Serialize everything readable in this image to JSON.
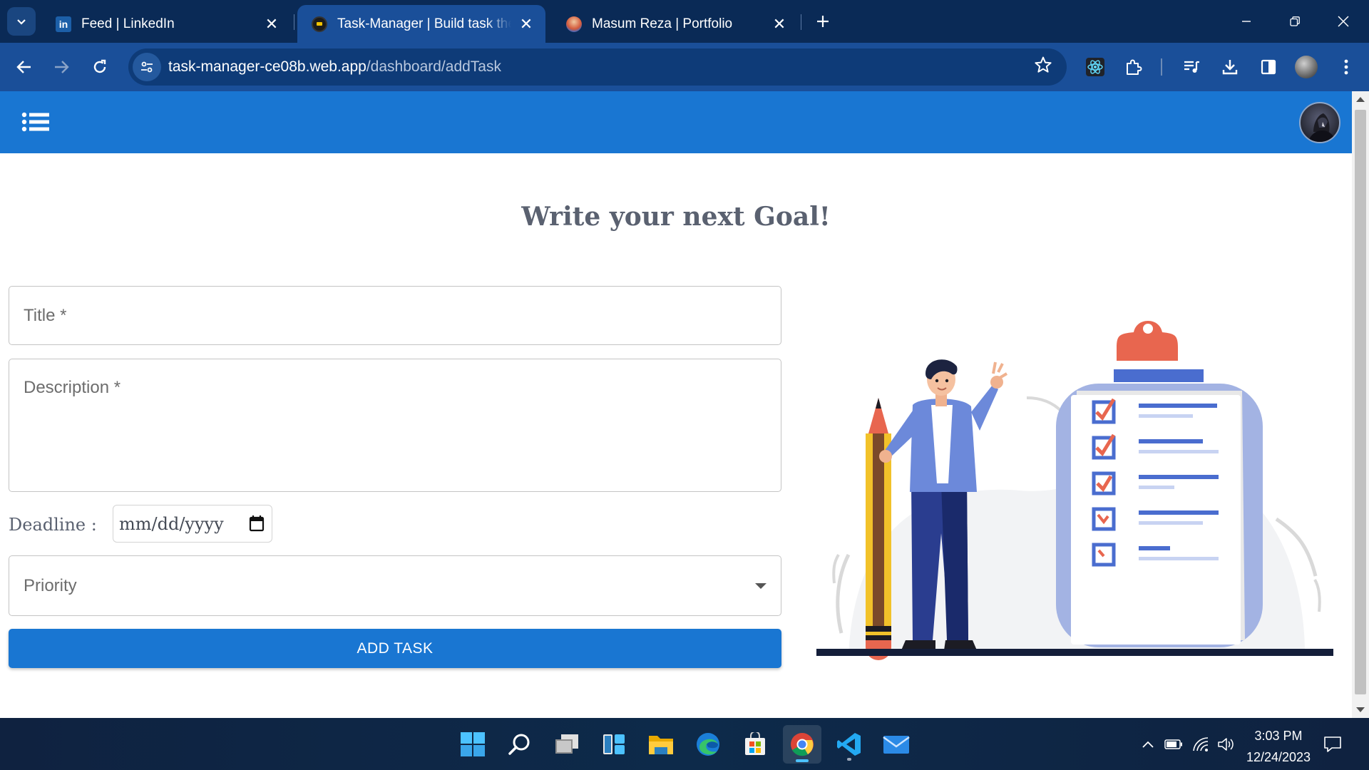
{
  "browser": {
    "tabs": [
      {
        "title": "Feed | LinkedIn",
        "favicon": "linkedin-icon",
        "active": false
      },
      {
        "title": "Task-Manager | Build task the w",
        "favicon": "task-manager-favicon",
        "active": true
      },
      {
        "title": "Masum Reza | Portfolio",
        "favicon": "portfolio-favicon",
        "active": false
      }
    ],
    "url_host": "task-manager-ce08b.web.app",
    "url_path": "/dashboard/addTask",
    "colors": {
      "tabbar": "#0a2a56",
      "toolbar": "#1a4f99"
    }
  },
  "app": {
    "header_color": "#1976d2",
    "page_title": "Write your next Goal!",
    "form": {
      "title_label": "Title *",
      "description_label": "Description *",
      "deadline_label": "Deadline :",
      "deadline_placeholder": "mm/dd/yyyy",
      "priority_label": "Priority",
      "submit_label": "ADD TASK"
    }
  },
  "taskbar": {
    "apps": [
      "start-icon",
      "search-icon",
      "task-view-icon",
      "widgets-icon",
      "file-explorer-icon",
      "edge-icon",
      "store-icon",
      "chrome-icon",
      "vscode-icon",
      "mail-icon"
    ],
    "active_app": "chrome-icon",
    "time": "3:03 PM",
    "date": "12/24/2023"
  }
}
